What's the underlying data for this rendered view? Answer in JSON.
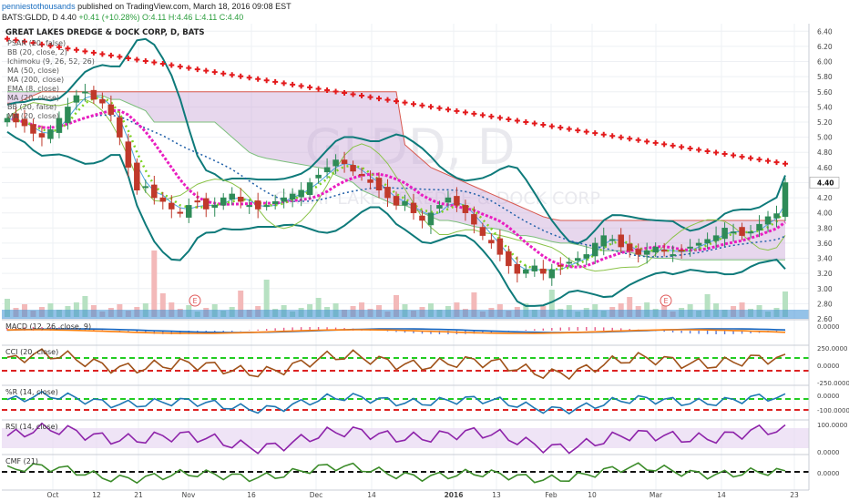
{
  "header": {
    "author": "penniestothousands",
    "published_text": "published on TradingView.com, March 18, 2016 09:08 EST",
    "symbol_line": "BATS:GLDD, D",
    "last": "4.40",
    "change": "+0.41 (+10.28%)",
    "ohlc": [
      "O:4.11",
      "H:4.46",
      "L:4.11",
      "C:4.40"
    ]
  },
  "watermark": {
    "ticker": "GLDD, D",
    "company": "GREAT LAKES DREDGE & DOCK CORP"
  },
  "legend": {
    "title": "GREAT LAKES DREDGE & DOCK CORP, D, BATS",
    "items": [
      "PSAR (20, false)",
      "BB (20, close, 2)",
      "Ichimoku (9, 26, 52, 26)",
      "MA (50, close)",
      "MA (200, close)",
      "EMA (8, close)",
      "MA (20, close)",
      "BB (20, false)",
      "MA (20, close)"
    ]
  },
  "price_axis_labels": [
    "6.40",
    "6.20",
    "6.00",
    "5.80",
    "5.60",
    "5.40",
    "5.20",
    "5.00",
    "4.80",
    "4.60",
    "4.40",
    "4.20",
    "4.00",
    "3.80",
    "3.60",
    "3.40",
    "3.20",
    "3.00",
    "2.80",
    "2.60"
  ],
  "last_price_label": "4.40",
  "x_axis_labels": [
    "Oct",
    "12",
    "21",
    "Nov",
    "16",
    "Dec",
    "14",
    "2016",
    "13",
    "Feb",
    "10",
    "Mar",
    "14",
    "23"
  ],
  "earnings_marker": "E",
  "panes": [
    {
      "name": "macd",
      "label": "MACD (12, 26, close, 9)",
      "ticks": [
        "0.0000"
      ]
    },
    {
      "name": "cci",
      "label": "CCI (20, close)",
      "ticks": [
        "250.0000",
        "0.0000",
        "-250.0000"
      ]
    },
    {
      "name": "williams-r",
      "label": "%R (14, close)",
      "ticks": [
        "0.0000",
        "-100.0000"
      ]
    },
    {
      "name": "rsi",
      "label": "RSI (14, close)",
      "ticks": [
        "100.0000",
        "0.0000"
      ]
    },
    {
      "name": "cmf",
      "label": "CMF (21)",
      "ticks": [
        "0.0000"
      ]
    }
  ],
  "colors": {
    "up": "#2e8b57",
    "down": "#c0392b",
    "psar": "#e31a1c",
    "bb": "#0e7a7a",
    "ma50": "#1f5fa8",
    "ma200": "#e31a1c",
    "ema8": "#7ed321",
    "ma20": "#e91ec0",
    "cloud": "#c9a6d8",
    "lagging": "#8bc34a",
    "macd": "#1565c0",
    "signal": "#ff7f0e",
    "cci": "#a0521a",
    "wr": "#1f78b4",
    "rsi": "#8e24aa",
    "cmf": "#3c8c2a",
    "green_band": "#22cc22",
    "red_band": "#dd2222"
  },
  "chart_data": {
    "type": "candlestick",
    "title": "GREAT LAKES DREDGE & DOCK CORP, D, BATS",
    "ylim": [
      2.6,
      6.5
    ],
    "x_range": [
      "2015-09-28",
      "2016-03-23"
    ],
    "y_ticks": [
      6.4,
      6.2,
      6.0,
      5.8,
      5.6,
      5.4,
      5.2,
      5.0,
      4.8,
      4.6,
      4.4,
      4.2,
      4.0,
      3.8,
      3.6,
      3.4,
      3.2,
      3.0,
      2.8,
      2.6
    ],
    "close_series": [
      5.25,
      5.2,
      5.15,
      5.05,
      5.0,
      5.1,
      5.25,
      5.4,
      5.55,
      5.6,
      5.5,
      5.45,
      5.3,
      5.0,
      4.6,
      4.3,
      4.35,
      4.2,
      4.15,
      4.05,
      4.0,
      4.1,
      4.15,
      4.05,
      4.1,
      4.2,
      4.25,
      4.15,
      4.1,
      4.05,
      4.1,
      4.15,
      4.2,
      4.25,
      4.3,
      4.4,
      4.5,
      4.6,
      4.7,
      4.65,
      4.55,
      4.5,
      4.4,
      4.3,
      4.2,
      4.1,
      4.15,
      4.0,
      3.9,
      4.0,
      4.1,
      4.2,
      4.1,
      4.0,
      3.85,
      3.7,
      3.6,
      3.45,
      3.3,
      3.2,
      3.25,
      3.3,
      3.2,
      3.25,
      3.3,
      3.35,
      3.4,
      3.45,
      3.6,
      3.7,
      3.65,
      3.55,
      3.5,
      3.45,
      3.5,
      3.55,
      3.5,
      3.45,
      3.5,
      3.55,
      3.6,
      3.65,
      3.7,
      3.8,
      3.75,
      3.7,
      3.75,
      3.85,
      3.95,
      3.99,
      4.4
    ],
    "psar_line": {
      "start": [
        0,
        6.3
      ],
      "end": [
        90,
        4.65
      ]
    },
    "last_close": 4.4,
    "last_ohlc": {
      "open": 4.11,
      "high": 4.46,
      "low": 4.11,
      "close": 4.4
    }
  }
}
